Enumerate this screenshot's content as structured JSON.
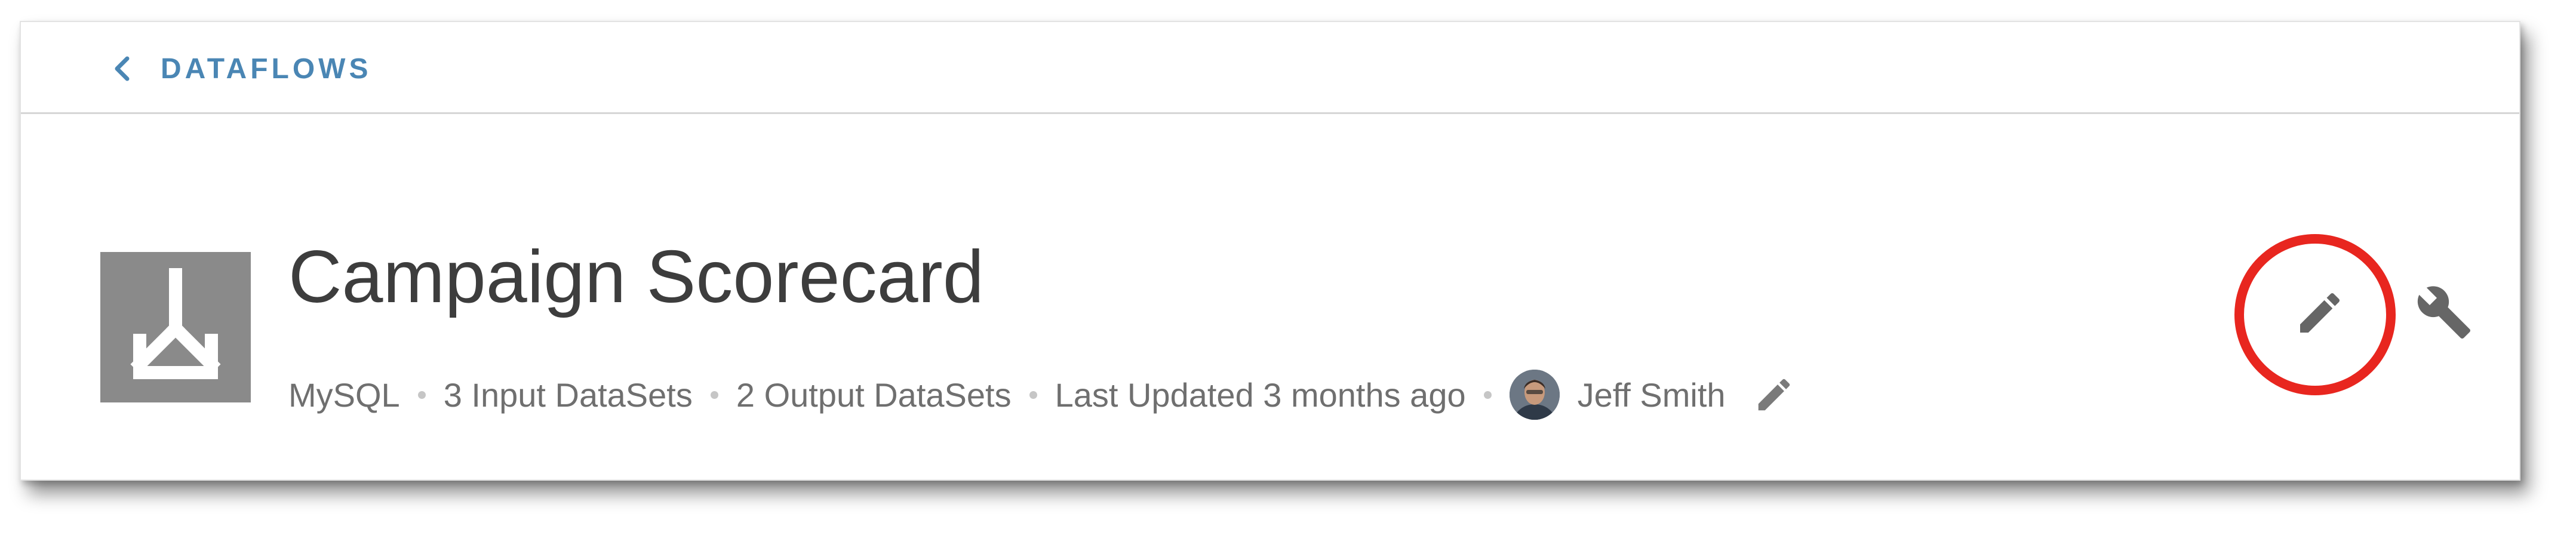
{
  "nav": {
    "back_label": "DATAFLOWS",
    "back_icon": "chevron-left-icon"
  },
  "dataflow": {
    "icon": "dataflow-merge-icon",
    "title": "Campaign Scorecard",
    "type": "MySQL",
    "inputs": "3 Input DataSets",
    "outputs": "2 Output DataSets",
    "last_updated": "Last Updated 3 months ago",
    "owner": "Jeff Smith"
  },
  "actions": {
    "edit_icon": "pencil-icon",
    "settings_icon": "wrench-icon",
    "edit_highlighted": true
  },
  "colors": {
    "accent": "#4a86b4",
    "highlight": "#e8261f",
    "logo_bg": "#8a8a8a",
    "title_text": "#3d3d3d",
    "meta_text": "#6f6f6f",
    "icon_gray": "#6a6a6a"
  }
}
